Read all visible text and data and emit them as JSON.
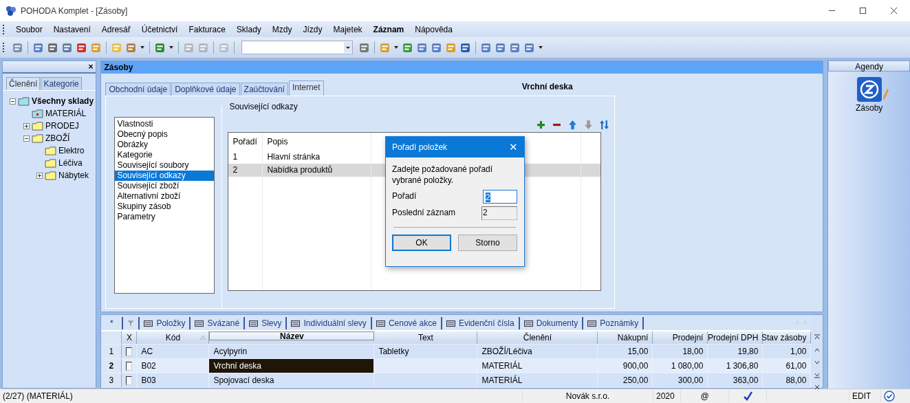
{
  "window": {
    "title": "POHODA Komplet - [Zásoby]"
  },
  "menu": [
    {
      "label": "Soubor",
      "bold": false
    },
    {
      "label": "Nastavení",
      "bold": false
    },
    {
      "label": "Adresář",
      "bold": false
    },
    {
      "label": "Účetnictví",
      "bold": false
    },
    {
      "label": "Fakturace",
      "bold": false
    },
    {
      "label": "Sklady",
      "bold": false
    },
    {
      "label": "Mzdy",
      "bold": false
    },
    {
      "label": "Jízdy",
      "bold": false
    },
    {
      "label": "Majetek",
      "bold": false
    },
    {
      "label": "Záznam",
      "bold": true
    },
    {
      "label": "Nápověda",
      "bold": false
    }
  ],
  "left_panel": {
    "close": "×",
    "tabs": [
      {
        "label": "Členění",
        "selected": true
      },
      {
        "label": "Kategorie",
        "selected": false
      }
    ],
    "tree": [
      {
        "label": "Všechny sklady",
        "expanded": true,
        "children": [
          {
            "label": "MATERIÁL",
            "marked": true
          },
          {
            "label": "PRODEJ",
            "expanded": false
          },
          {
            "label": "ZBOŽÍ",
            "expanded": true,
            "children": [
              {
                "label": "Elektro"
              },
              {
                "label": "Léčiva"
              },
              {
                "label": "Nábytek",
                "expanded": false
              }
            ]
          }
        ]
      }
    ]
  },
  "main": {
    "title": "Zásoby",
    "heading": "Vrchní deska",
    "tabs": [
      {
        "label": "Obchodní údaje",
        "selected": false
      },
      {
        "label": "Doplňkové údaje",
        "selected": false
      },
      {
        "label": "Zaúčtování",
        "selected": false
      },
      {
        "label": "Internet",
        "selected": true
      }
    ],
    "sections": [
      {
        "label": "Vlastnosti",
        "selected": false
      },
      {
        "label": "Obecný popis",
        "selected": false
      },
      {
        "label": "Obrázky",
        "selected": false
      },
      {
        "label": "Kategorie",
        "selected": false
      },
      {
        "label": "Související soubory",
        "selected": false
      },
      {
        "label": "Související odkazy",
        "selected": true
      },
      {
        "label": "Související zboží",
        "selected": false
      },
      {
        "label": "Alternativní zboží",
        "selected": false
      },
      {
        "label": "Skupiny zásob",
        "selected": false
      },
      {
        "label": "Parametry",
        "selected": false
      }
    ],
    "group_title": "Související odkazy",
    "links": {
      "columns": [
        "Pořadí",
        "Popis"
      ],
      "rows": [
        {
          "order": "1",
          "description": "Hlavní stránka",
          "selected": false
        },
        {
          "order": "2",
          "description": "Nabídka produktů",
          "selected": true
        }
      ]
    }
  },
  "dialog": {
    "title": "Pořadí položek",
    "close": "✕",
    "message": "Zadejte požadované pořadí vybrané položky.",
    "fields": [
      {
        "label": "Pořadí",
        "value": "2",
        "kind": "input"
      },
      {
        "label": "Poslední záznam",
        "value": "2",
        "kind": "readonly"
      }
    ],
    "buttons": [
      {
        "label": "OK",
        "default": true
      },
      {
        "label": "Storno",
        "default": false
      }
    ]
  },
  "bottom": {
    "new_tab": "*",
    "tabs": [
      {
        "label": "Položky"
      },
      {
        "label": "Svázané"
      },
      {
        "label": "Slevy"
      },
      {
        "label": "Individuální slevy"
      },
      {
        "label": "Cenové akce"
      },
      {
        "label": "Evidenční čísla"
      },
      {
        "label": "Dokumenty"
      },
      {
        "label": "Poznámky"
      }
    ],
    "columns": [
      {
        "label": "X",
        "active": false,
        "sorted": false
      },
      {
        "label": "Kód",
        "active": false,
        "sorted": true
      },
      {
        "label": "Název",
        "active": true,
        "sorted": false
      },
      {
        "label": "Text",
        "active": false,
        "sorted": false
      },
      {
        "label": "Členění",
        "active": false,
        "sorted": false
      },
      {
        "label": "Nákupní",
        "active": false,
        "sorted": false
      },
      {
        "label": "Prodejní",
        "active": false,
        "sorted": false
      },
      {
        "label": "Prodejní DPH",
        "active": false,
        "sorted": false
      },
      {
        "label": "Stav zásoby",
        "active": false,
        "sorted": false
      }
    ],
    "rows": [
      {
        "number": "1",
        "checked": false,
        "code": "AC",
        "name": "Acylpyrin",
        "text": "Tabletky",
        "category": "ZBOŽÍ/Léčiva",
        "purchase": "15,00",
        "sale": "18,00",
        "sale_vat": "19,80",
        "stock": "1,00",
        "selected": false
      },
      {
        "number": "2",
        "checked": false,
        "code": "B02",
        "name": "Vrchní deska",
        "text": "",
        "category": "MATERIÁL",
        "purchase": "900,00",
        "sale": "1 080,00",
        "sale_vat": "1 306,80",
        "stock": "61,00",
        "selected": true
      },
      {
        "number": "3",
        "checked": false,
        "code": "B03",
        "name": "Spojovací deska",
        "text": "",
        "category": "MATERIÁL",
        "purchase": "250,00",
        "sale": "300,00",
        "sale_vat": "363,00",
        "stock": "88,00",
        "selected": false
      }
    ]
  },
  "agendy": {
    "title": "Agendy",
    "items": [
      {
        "label": "Zásoby"
      }
    ]
  },
  "status_bar": {
    "record": "(2/27) (MATERIÁL)",
    "company": "Novák s.r.o.",
    "year": "2020",
    "mail": "@",
    "mode": "EDIT"
  }
}
